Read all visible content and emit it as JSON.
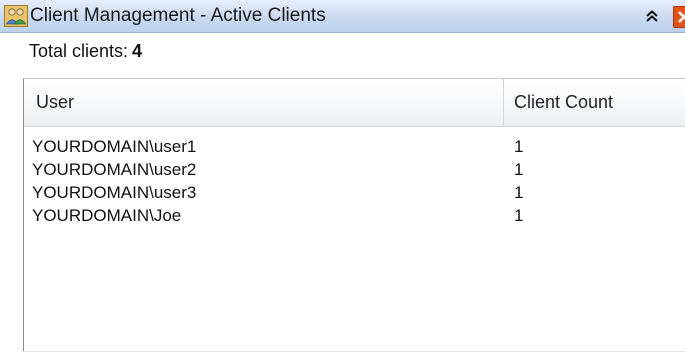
{
  "window": {
    "title": "Client Management - Active Clients",
    "icon": "users-group-icon",
    "collapse_icon": "double-chevron-up-icon",
    "close_icon": "close-icon"
  },
  "summary": {
    "label": "Total clients:",
    "value": "4"
  },
  "table": {
    "columns": [
      "User",
      "Client Count"
    ],
    "rows": [
      {
        "user": "YOURDOMAIN\\user1",
        "count": "1"
      },
      {
        "user": "YOURDOMAIN\\user2",
        "count": "1"
      },
      {
        "user": "YOURDOMAIN\\user3",
        "count": "1"
      },
      {
        "user": "YOURDOMAIN\\Joe",
        "count": "1"
      }
    ]
  },
  "colors": {
    "titlebar": "#c9d9f1",
    "close_button": "#e0541b"
  }
}
